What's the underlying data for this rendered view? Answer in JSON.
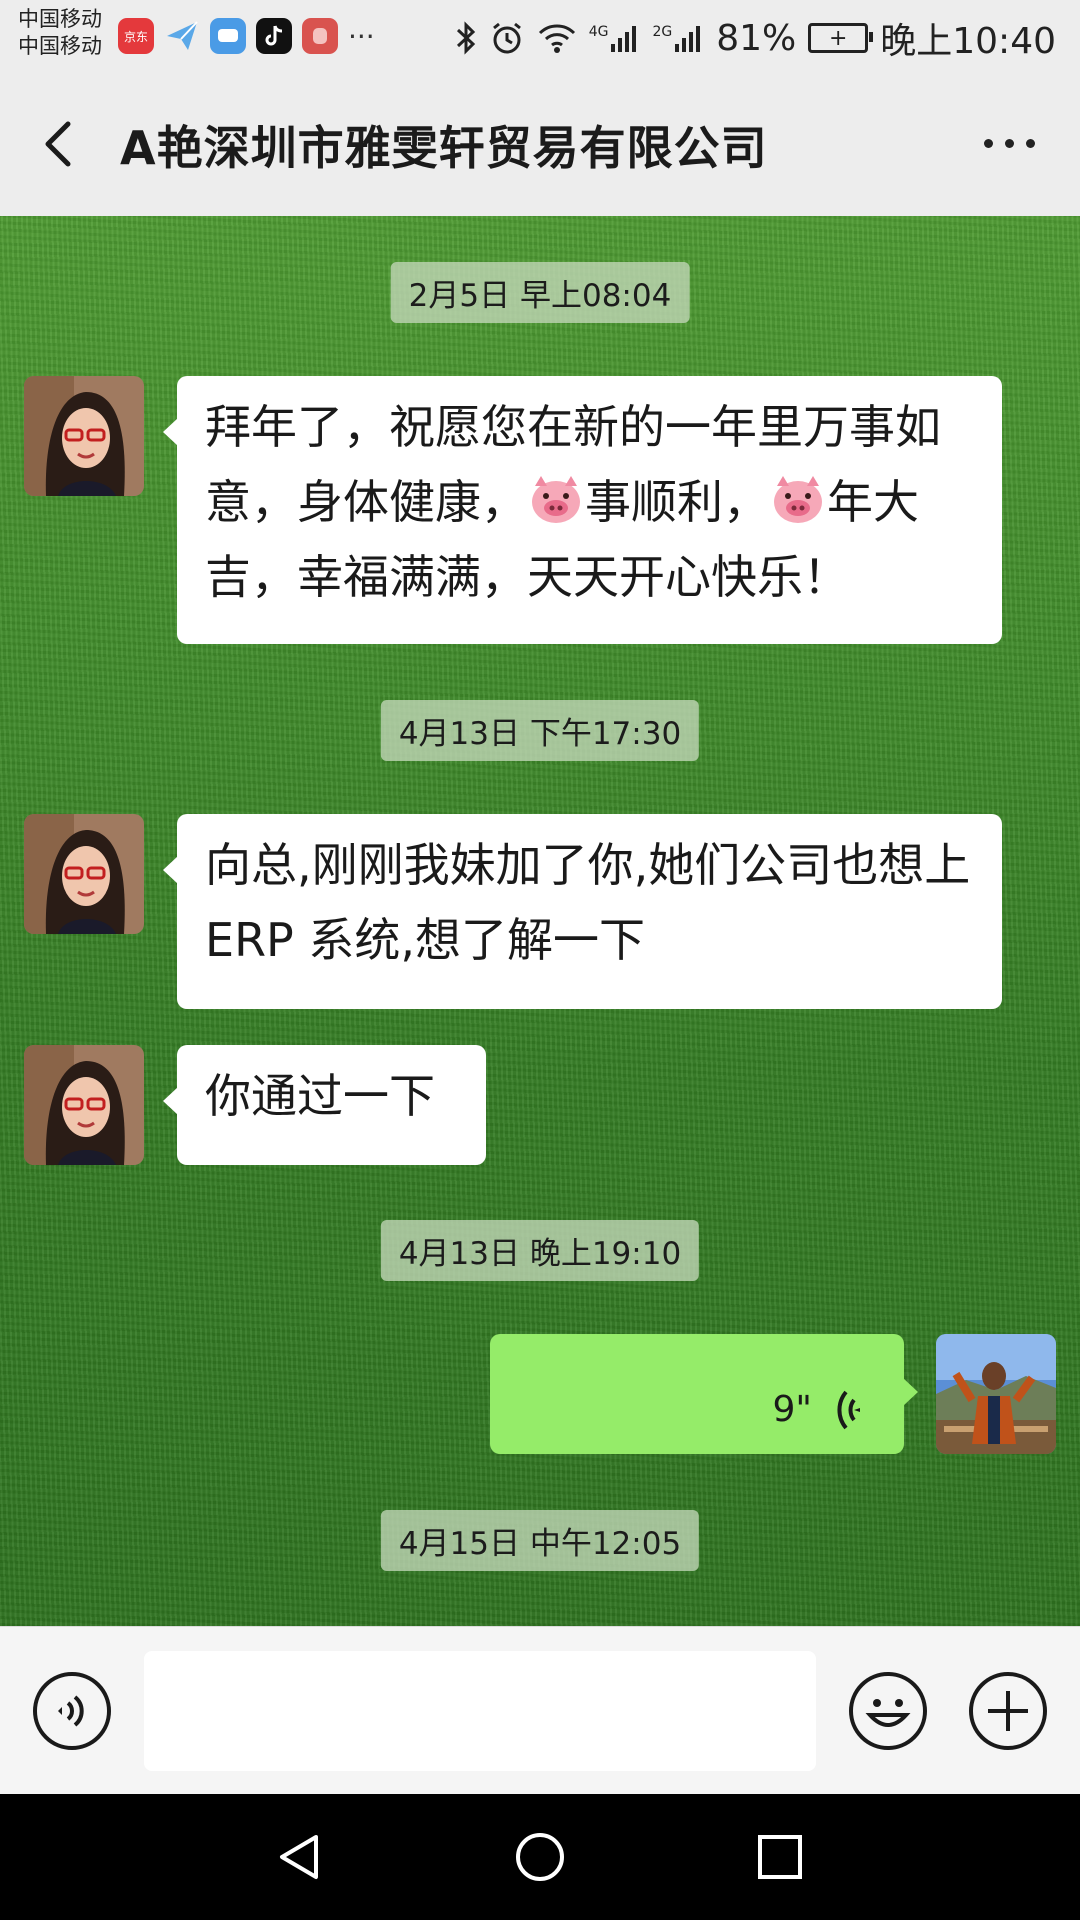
{
  "status_bar": {
    "carrier_1": "中国移动",
    "carrier_2": "中国移动",
    "app_icon_jd_label": "京东",
    "more_dots": "···",
    "net_4g": "4G",
    "net_2g": "2G",
    "battery_percent": "81%",
    "time": "晚上10:40"
  },
  "header": {
    "title": "A艳深圳市雅雯轩贸易有限公司"
  },
  "messages": {
    "ts1": "2月5日 早上08:04",
    "msg1_part1": "拜年了，祝愿您在新的一年里万事如意，身体健康，",
    "msg1_part2": "事顺利，",
    "msg1_part3": "年大吉，幸福满满，天天开心快乐！",
    "ts2": "4月13日 下午17:30",
    "msg2": "向总,刚刚我妹加了你,她们公司也想上 ERP 系统,想了解一下",
    "msg3": "你通过一下",
    "ts3": "4月13日 晚上19:10",
    "voice_duration": "9\"",
    "ts4": "4月15日 中午12:05"
  },
  "input_bar": {
    "text_value": ""
  },
  "colors": {
    "voice_bubble": "#95ec69",
    "chat_background": "#3f8a2a",
    "header_bg": "#ededed"
  },
  "icons": {
    "back": "chevron-left-icon",
    "more": "more-dots-icon",
    "voice_mode": "voice-icon",
    "emoji": "emoji-icon",
    "plus": "plus-icon"
  }
}
